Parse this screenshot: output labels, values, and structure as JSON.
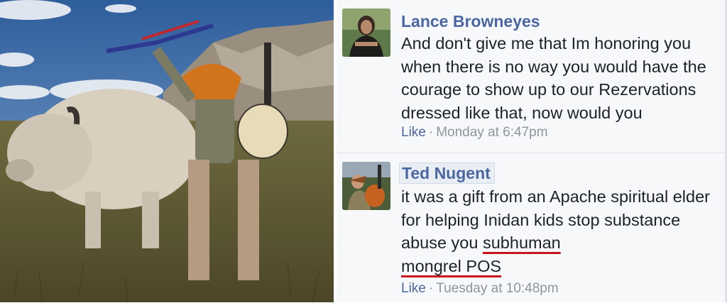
{
  "photo": {
    "alt_subject": "man in headdress holding bow and guitar beside white bison"
  },
  "comments": [
    {
      "author": "Lance Browneyes",
      "text": "And don't give me that Im honoring you when there is no way you would have the courage to show up to our Rezervations dressed like that, now would you",
      "like_label": "Like",
      "separator": "·",
      "timestamp": "Monday at 6:47pm"
    },
    {
      "author": "Ted Nugent",
      "text_plain": "it was a gift from an Apache spiritual elder for helping Inidan kids stop substance abuse you ",
      "text_underlined_1": "subhuman",
      "text_underlined_2": "mongrel POS",
      "like_label": "Like",
      "separator": "·",
      "timestamp": "Tuesday at 10:48pm"
    }
  ],
  "colors": {
    "author_link": "#4b67a1",
    "body_text": "#1d2129",
    "meta_text": "#90949c",
    "underline": "#c8161d",
    "comment_bg": "#f7f8fa"
  }
}
